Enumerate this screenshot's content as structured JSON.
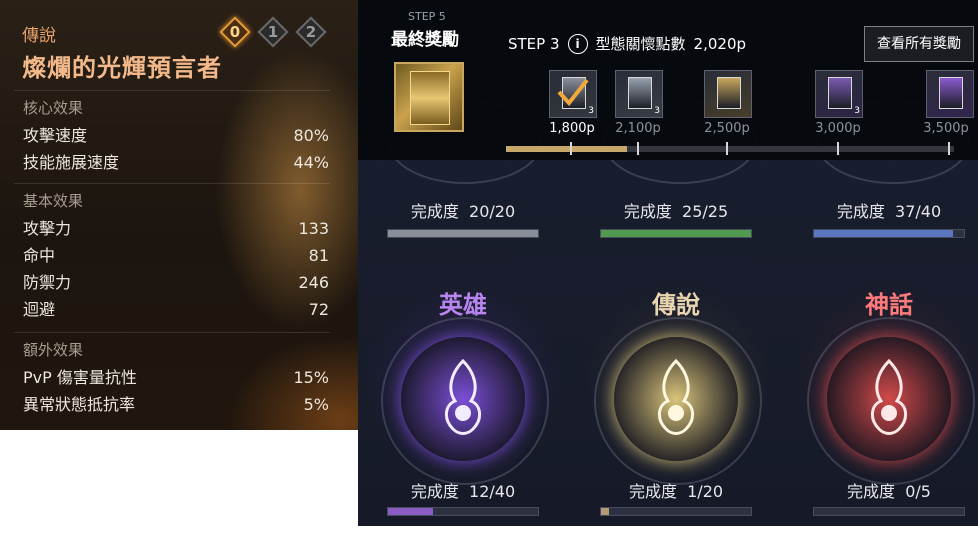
{
  "left_panel": {
    "rarity": "傳說",
    "title": "燦爛的光輝預言者",
    "star_levels": [
      "0",
      "1",
      "2"
    ],
    "active_star": "0",
    "sections": [
      {
        "title": "核心效果",
        "stats": [
          {
            "name": "攻擊速度",
            "value": "80%"
          },
          {
            "name": "技能施展速度",
            "value": "44%"
          }
        ]
      },
      {
        "title": "基本效果",
        "stats": [
          {
            "name": "攻擊力",
            "value": "133"
          },
          {
            "name": "命中",
            "value": "81"
          },
          {
            "name": "防禦力",
            "value": "246"
          },
          {
            "name": "迴避",
            "value": "72"
          }
        ]
      },
      {
        "title": "額外效果",
        "stats": [
          {
            "name": "PvP 傷害量抗性",
            "value": "15%"
          },
          {
            "name": "異常狀態抵抗率",
            "value": "5%"
          }
        ]
      }
    ]
  },
  "top_bar": {
    "final_step_label": "STEP 5",
    "final_reward_label": "最終獎勵",
    "current_step": "STEP 3",
    "points_label": "型態關懷點數",
    "points_value": "2,020p",
    "view_all_button": "查看所有獎勵",
    "track_progress": 0.27,
    "rewards": [
      {
        "points": "1,800p",
        "count": "3",
        "claimed": true,
        "color": "#8a8f9c"
      },
      {
        "points": "2,100p",
        "count": "3",
        "claimed": false,
        "color": "#9aa2b0"
      },
      {
        "points": "2,500p",
        "count": "",
        "claimed": false,
        "color": "#c9a75e"
      },
      {
        "points": "3,000p",
        "count": "3",
        "claimed": false,
        "color": "#7a5ab3"
      },
      {
        "points": "3,500p",
        "count": "",
        "claimed": false,
        "color": "#8b5ad0"
      }
    ]
  },
  "collection": {
    "tiers": [
      {
        "name": "",
        "progress_label": "完成度",
        "progress": "20/20",
        "fraction": 1.0,
        "bar_color": "#8a8e98"
      },
      {
        "name": "",
        "progress_label": "完成度",
        "progress": "25/25",
        "fraction": 1.0,
        "bar_color": "#4f9a4f"
      },
      {
        "name": "",
        "progress_label": "完成度",
        "progress": "37/40",
        "fraction": 0.925,
        "bar_color": "#5b77c0"
      },
      {
        "name": "英雄",
        "progress_label": "完成度",
        "progress": "12/40",
        "fraction": 0.3,
        "bar_color": "#8a5bc2",
        "name_color": "#b985f0",
        "glow": "#7b4fd6"
      },
      {
        "name": "傳說",
        "progress_label": "完成度",
        "progress": "1/20",
        "fraction": 0.05,
        "bar_color": "#b49a74",
        "name_color": "#e9d6b0",
        "glow": "#d8c47a"
      },
      {
        "name": "神話",
        "progress_label": "完成度",
        "progress": "0/5",
        "fraction": 0.0,
        "bar_color": "#c04848",
        "name_color": "#ff7a7a",
        "glow": "#d24a4a"
      }
    ]
  }
}
